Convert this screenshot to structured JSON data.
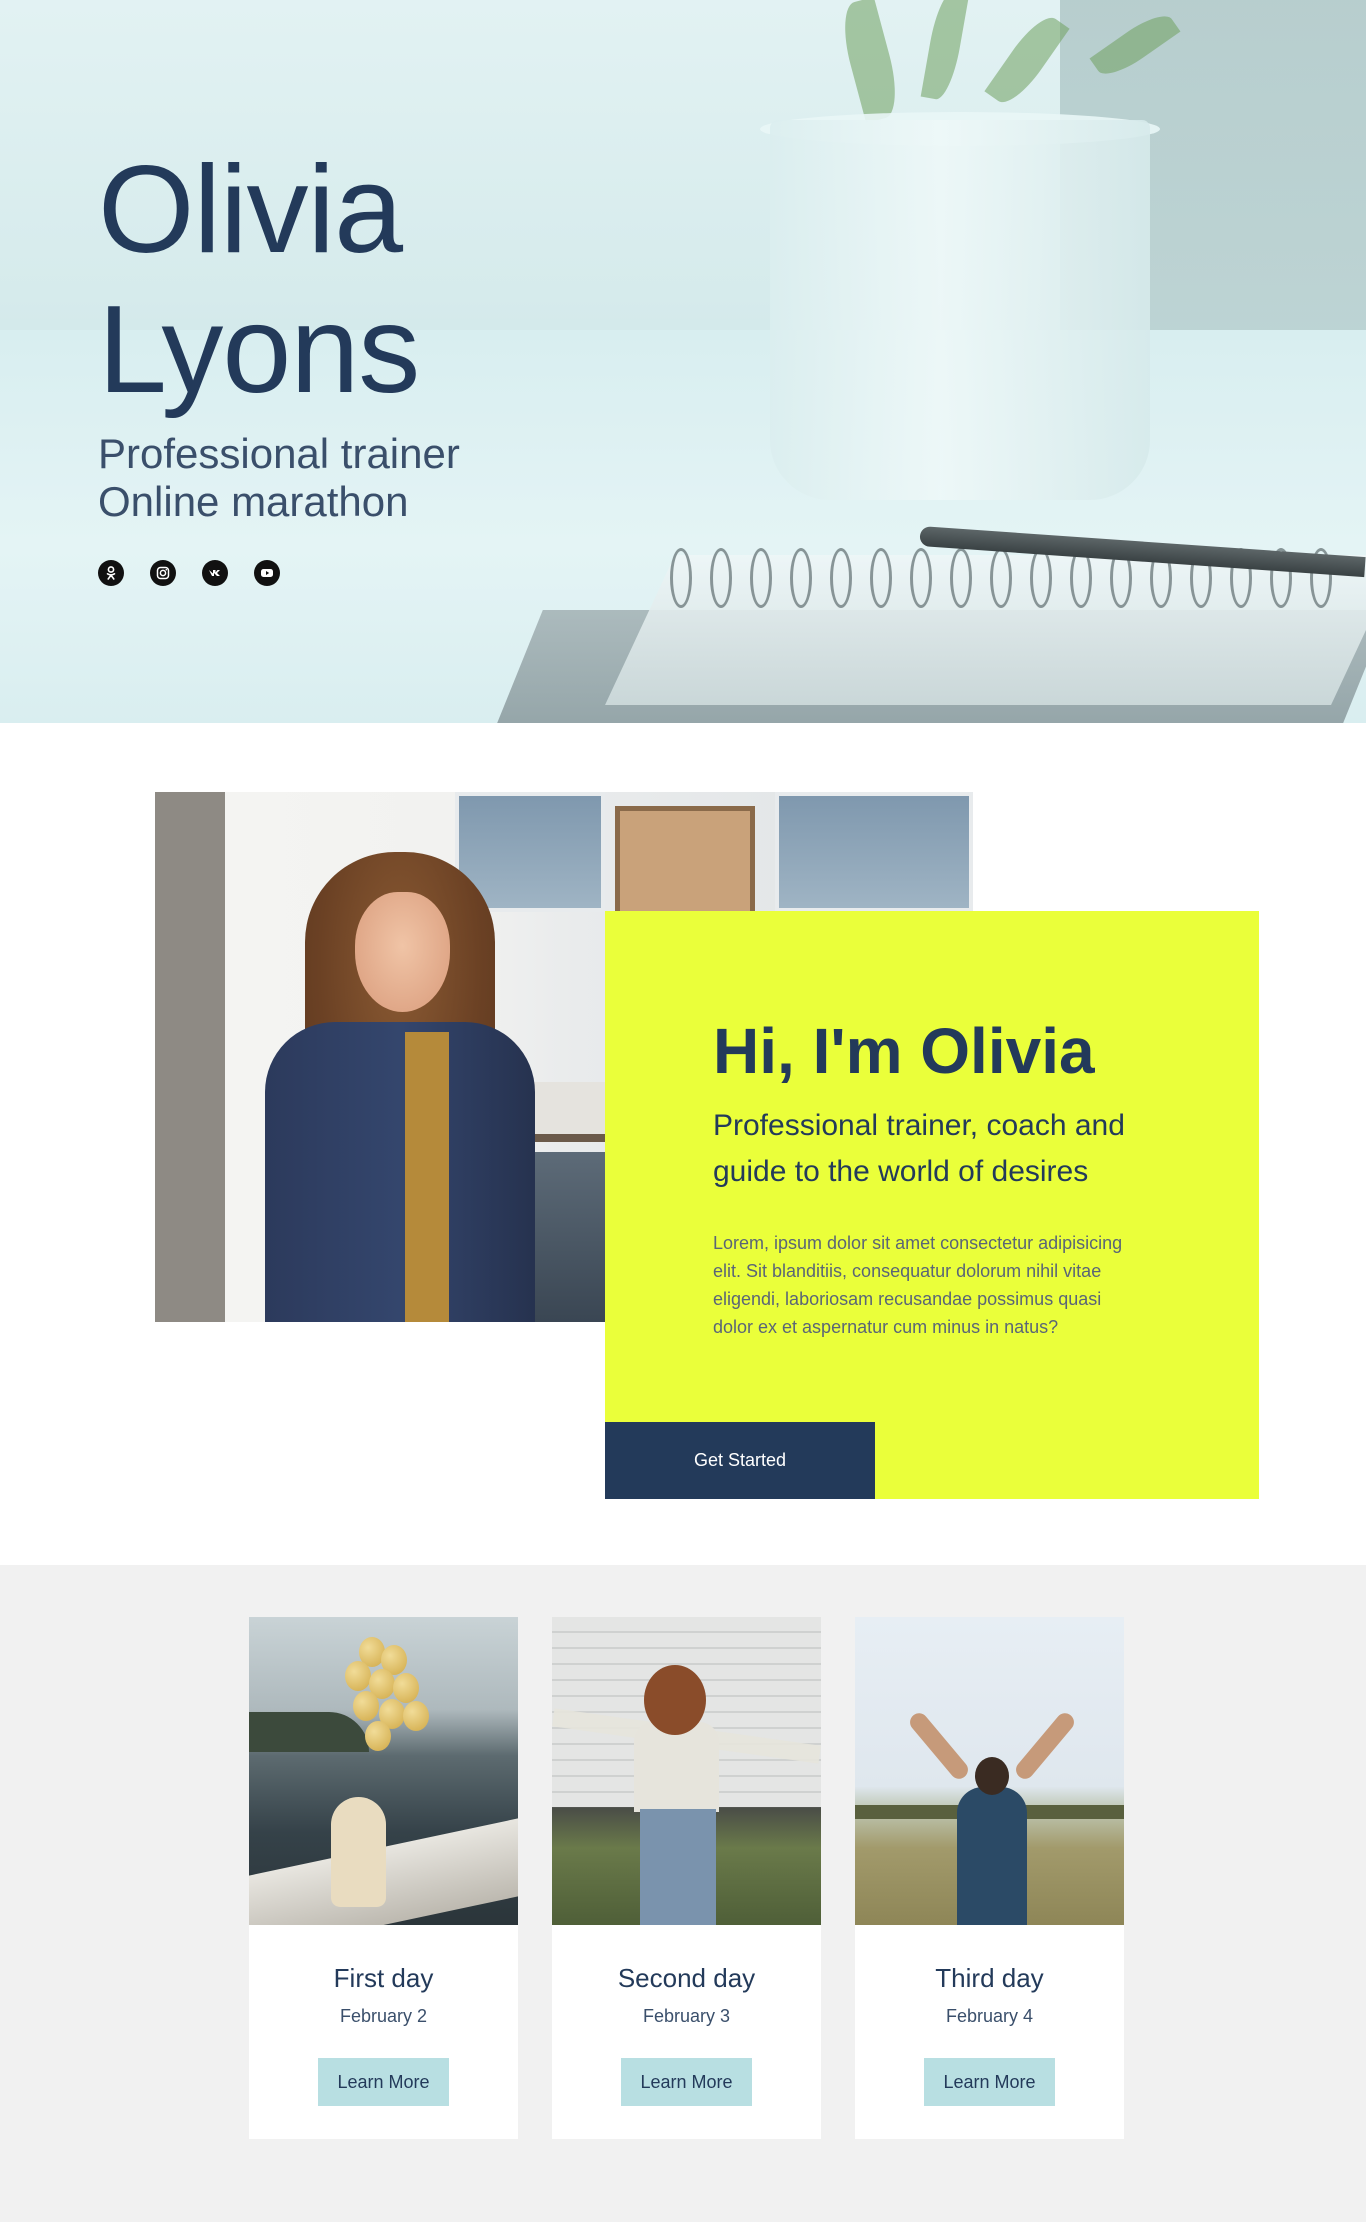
{
  "hero": {
    "name_line1": "Olivia",
    "name_line2": "Lyons",
    "subtitle_line1": "Professional trainer",
    "subtitle_line2": "Online marathon",
    "socials": [
      {
        "icon": "odnoklassniki-icon"
      },
      {
        "icon": "instagram-icon"
      },
      {
        "icon": "vk-icon"
      },
      {
        "icon": "youtube-icon"
      }
    ]
  },
  "about": {
    "title": "Hi, I'm Olivia",
    "subtitle": "Professional trainer, coach and guide to the world of desires",
    "body": "Lorem, ipsum dolor sit amet consectetur adipisicing elit. Sit blanditiis, consequatur dolorum nihil vitae eligendi, laboriosam recusandae possimus quasi dolor ex et aspernatur cum minus in natus?",
    "cta_label": "Get Started",
    "card_color": "#eaff3a",
    "cta_color": "#233a5a"
  },
  "events": {
    "cards": [
      {
        "title": "First day",
        "date": "February 2",
        "button": "Learn More"
      },
      {
        "title": "Second day",
        "date": "February 3",
        "button": "Learn More"
      },
      {
        "title": "Third day",
        "date": "February 4",
        "button": "Learn More"
      }
    ],
    "button_color": "#b8dfe2"
  },
  "colors": {
    "text_primary": "#233a5a",
    "events_background": "#f1f1f1"
  }
}
